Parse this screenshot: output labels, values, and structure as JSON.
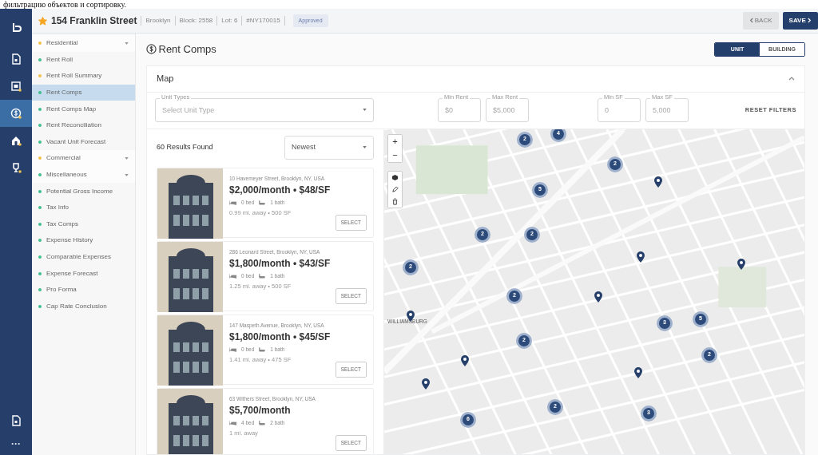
{
  "caption": "фильтрацию объектов и сортировку.",
  "header": {
    "starred": true,
    "title": "154 Franklin Street",
    "chips": [
      "Brooklyn",
      "Block: 2558",
      "Lot: 6",
      "#NY170015"
    ],
    "status": "Approved",
    "back": "BACK",
    "save": "SAVE"
  },
  "rail": [
    {
      "kind": "doc",
      "selected": false
    },
    {
      "kind": "screen",
      "selected": false
    },
    {
      "kind": "dollar",
      "selected": true
    },
    {
      "kind": "house",
      "selected": false
    },
    {
      "kind": "trophy",
      "selected": false
    }
  ],
  "rail_bottom": [
    {
      "kind": "doc"
    },
    {
      "kind": "more",
      "label": "···"
    }
  ],
  "sidebar": [
    {
      "label": "Residential",
      "section": true,
      "color": "#f2c14e",
      "selected": false
    },
    {
      "label": "Rent Roll",
      "section": false,
      "color": "#3fbf8f",
      "selected": false
    },
    {
      "label": "Rent Roll Summary",
      "section": false,
      "color": "#f2c14e",
      "selected": false
    },
    {
      "label": "Rent Comps",
      "section": false,
      "color": "#3fbf8f",
      "selected": true
    },
    {
      "label": "Rent Comps Map",
      "section": false,
      "color": "#3fbf8f",
      "selected": false
    },
    {
      "label": "Rent Reconciliation",
      "section": false,
      "color": "#3fbf8f",
      "selected": false
    },
    {
      "label": "Vacant Unit Forecast",
      "section": false,
      "color": "#3fbf8f",
      "selected": false
    },
    {
      "label": "Commercial",
      "section": true,
      "color": "#f2c14e",
      "selected": false
    },
    {
      "label": "Miscellaneous",
      "section": true,
      "color": "#3fbf8f",
      "selected": false
    },
    {
      "label": "Potential Gross Income",
      "section": false,
      "color": "#3fbf8f",
      "selected": false
    },
    {
      "label": "Tax Info",
      "section": false,
      "color": "#3fbf8f",
      "selected": false
    },
    {
      "label": "Tax Comps",
      "section": false,
      "color": "#3fbf8f",
      "selected": false
    },
    {
      "label": "Expense History",
      "section": false,
      "color": "#3fbf8f",
      "selected": false
    },
    {
      "label": "Comparable Expenses",
      "section": false,
      "color": "#3fbf8f",
      "selected": false
    },
    {
      "label": "Expense Forecast",
      "section": false,
      "color": "#3fbf8f",
      "selected": false
    },
    {
      "label": "Pro Forma",
      "section": false,
      "color": "#3fbf8f",
      "selected": false
    },
    {
      "label": "Cap Rate Conclusion",
      "section": false,
      "color": "#3fbf8f",
      "selected": false
    }
  ],
  "page_title": "Rent Comps",
  "view_toggle": [
    {
      "label": "UNIT",
      "selected": true
    },
    {
      "label": "BUILDING",
      "selected": false
    }
  ],
  "panel": {
    "title": "Map",
    "expanded": true
  },
  "filters": {
    "unit_types": {
      "label": "Unit Types",
      "placeholder": "Select Unit Type"
    },
    "ranges": [
      {
        "label": "Min Rent",
        "placeholder": "$0"
      },
      {
        "label": "Max Rent",
        "placeholder": "$5,000"
      },
      {
        "label": "Min SF",
        "placeholder": "0"
      },
      {
        "label": "Max SF",
        "placeholder": "5,000"
      }
    ],
    "reset": "RESET FILTERS"
  },
  "results": {
    "count": "60 Results Found",
    "sort": "Newest"
  },
  "listings": [
    {
      "address": "10 Havemeyer Street, Brooklyn, NY, USA",
      "price": "$2,000/month • $48/SF",
      "beds": "0 bed",
      "baths": "1 bath",
      "meta": "0.99 mi. away • 500 SF",
      "action": "SELECT"
    },
    {
      "address": "286 Leonard Street, Brooklyn, NY, USA",
      "price": "$1,800/month • $43/SF",
      "beds": "0 bed",
      "baths": "1 bath",
      "meta": "1.25 mi. away • 500 SF",
      "action": "SELECT"
    },
    {
      "address": "147 Maspeth Avenue, Brooklyn, NY, USA",
      "price": "$1,800/month • $45/SF",
      "beds": "0 bed",
      "baths": "1 bath",
      "meta": "1.41 mi. away • 475 SF",
      "action": "SELECT"
    },
    {
      "address": "63 Withers Street, Brooklyn, NY, USA",
      "price": "$5,700/month",
      "beds": "4 bed",
      "baths": "2 bath",
      "meta": "1 mi. away",
      "action": "SELECT"
    }
  ],
  "map": {
    "zoom_in": "+",
    "zoom_out": "−",
    "place_label": "WILLIAMSBURG",
    "markers": [
      {
        "kind": "cluster",
        "count": "2"
      },
      {
        "kind": "cluster",
        "count": "4"
      },
      {
        "kind": "cluster",
        "count": "2"
      },
      {
        "kind": "cluster",
        "count": "5"
      },
      {
        "kind": "cluster",
        "count": "2"
      },
      {
        "kind": "cluster",
        "count": "2"
      },
      {
        "kind": "cluster",
        "count": "2"
      },
      {
        "kind": "cluster",
        "count": "2"
      },
      {
        "kind": "cluster",
        "count": "3"
      },
      {
        "kind": "cluster",
        "count": "5"
      },
      {
        "kind": "cluster",
        "count": "2"
      },
      {
        "kind": "cluster",
        "count": "2"
      },
      {
        "kind": "cluster",
        "count": "2"
      },
      {
        "kind": "cluster",
        "count": "3"
      },
      {
        "kind": "cluster",
        "count": "6"
      },
      {
        "kind": "pin"
      },
      {
        "kind": "pin"
      },
      {
        "kind": "pin"
      },
      {
        "kind": "pin"
      },
      {
        "kind": "pin"
      },
      {
        "kind": "pin"
      },
      {
        "kind": "pin"
      },
      {
        "kind": "pin"
      }
    ]
  }
}
